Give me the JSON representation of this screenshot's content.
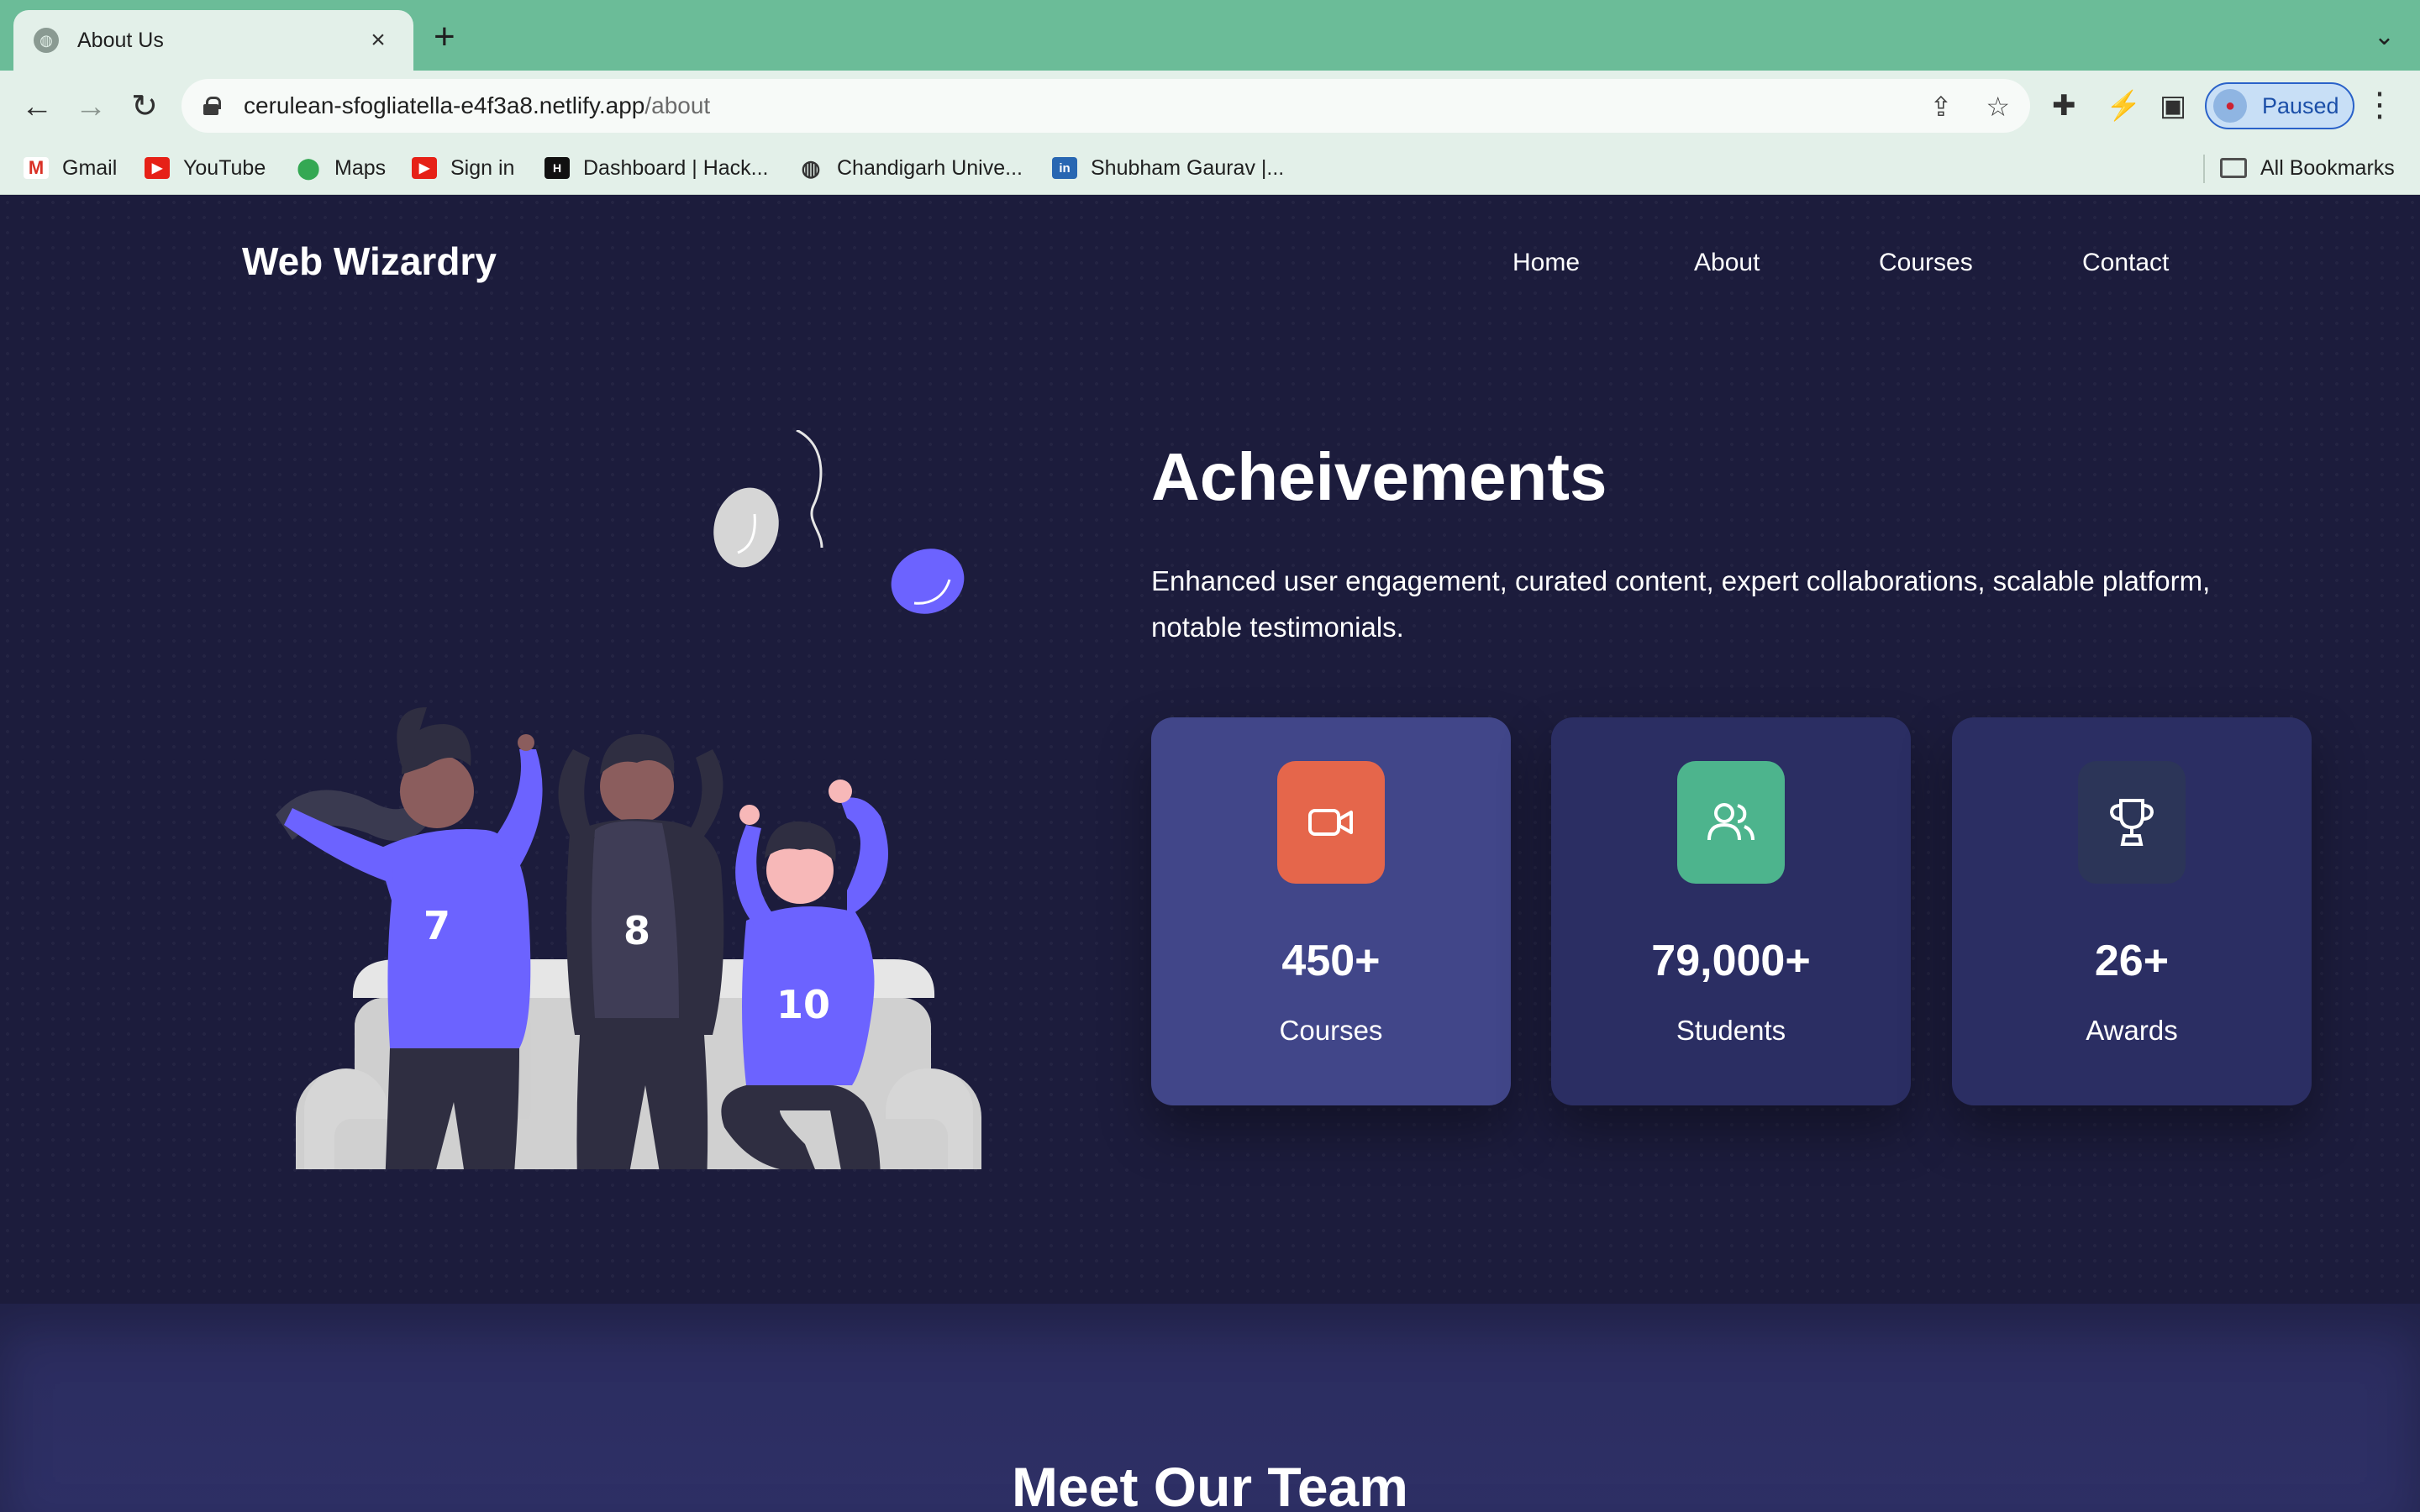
{
  "browser": {
    "tab_title": "About Us",
    "url_host": "cerulean-sfogliatella-e4f3a8.netlify.app",
    "url_path": "/about",
    "profile_label": "Paused",
    "bookmarks": [
      {
        "label": "Gmail",
        "icon": "gmail-icon"
      },
      {
        "label": "YouTube",
        "icon": "youtube-icon"
      },
      {
        "label": "Maps",
        "icon": "maps-icon"
      },
      {
        "label": "Sign in",
        "icon": "youtube-icon"
      },
      {
        "label": "Dashboard | Hack...",
        "icon": "hackerrank-icon"
      },
      {
        "label": "Chandigarh Unive...",
        "icon": "globe-icon"
      },
      {
        "label": "Shubham Gaurav |...",
        "icon": "linkedin-icon"
      }
    ],
    "all_bookmarks": "All Bookmarks"
  },
  "site": {
    "brand": "Web Wizardry",
    "nav": [
      "Home",
      "About",
      "Courses",
      "Contact"
    ]
  },
  "achievements": {
    "title": "Acheivements",
    "description": "Enhanced user engagement, curated content, expert collaborations, scalable platform, notable testimonials.",
    "stats": [
      {
        "value": "450+",
        "label": "Courses",
        "icon": "video-camera-icon",
        "card_color": "#414689",
        "icon_color": "#e5664b"
      },
      {
        "value": "79,000+",
        "label": "Students",
        "icon": "users-icon",
        "card_color": "#2b2e63",
        "icon_color": "#4db48d"
      },
      {
        "value": "26+",
        "label": "Awards",
        "icon": "trophy-icon",
        "card_color": "#2b2e63",
        "icon_color": "#2c3558"
      }
    ]
  },
  "illustration": {
    "jersey_numbers": [
      "7",
      "8",
      "10"
    ]
  },
  "team": {
    "title": "Meet Our Team"
  },
  "colors": {
    "page_bg": "#1c1c3c",
    "accent_purple": "#6c63ff",
    "chrome_green": "#6bbc98"
  }
}
